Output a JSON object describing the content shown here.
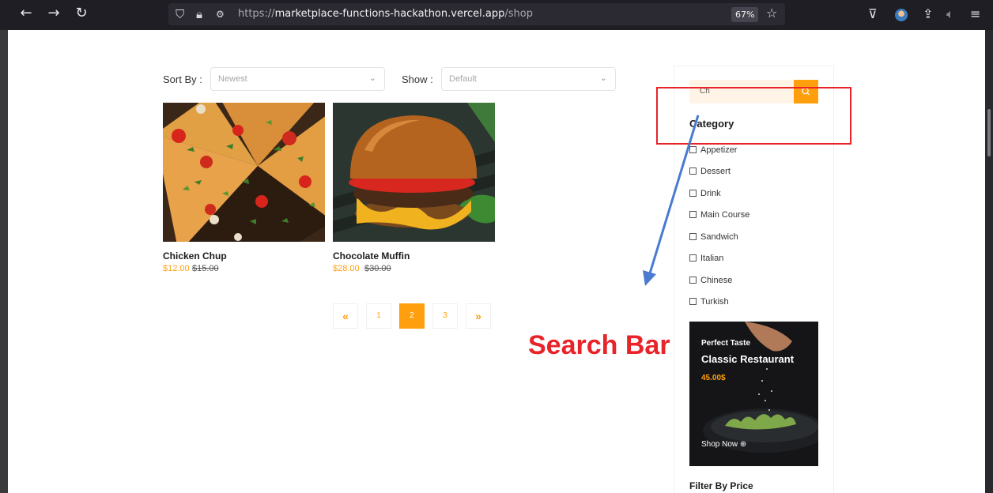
{
  "browser": {
    "url_prefix": "https://",
    "url_host": "marketplace-functions-hackathon.vercel.app",
    "url_path": "/shop",
    "zoom": "67%"
  },
  "toolbar": {
    "sort_label": "Sort By :",
    "sort_value": "Newest",
    "show_label": "Show :",
    "show_value": "Default"
  },
  "products": [
    {
      "name": "Chicken Chup",
      "price": "$12.00",
      "old_price": "$15.00"
    },
    {
      "name": "Chocolate Muffin",
      "price": "$28.00",
      "old_price": "$30.00"
    }
  ],
  "pagination": {
    "first": "«",
    "pages": [
      "1",
      "2",
      "3"
    ],
    "active_page": "2",
    "last": "»"
  },
  "sidebar": {
    "search_value": "Ch",
    "category_title": "Category",
    "categories": [
      "Appetizer",
      "Dessert",
      "Drink",
      "Main Course",
      "Sandwich",
      "Italian",
      "Chinese",
      "Turkish"
    ],
    "promo": {
      "subtitle": "Perfect Taste",
      "title": "Classic Restaurant",
      "price": "45.00$",
      "cta": "Shop Now"
    },
    "filter_title": "Filter By Price"
  },
  "annotation": {
    "label": "Search Bar",
    "color": "#e8232a"
  },
  "colors": {
    "accent": "#ff9f0d",
    "annotation_arrow": "#4a7bd0"
  }
}
